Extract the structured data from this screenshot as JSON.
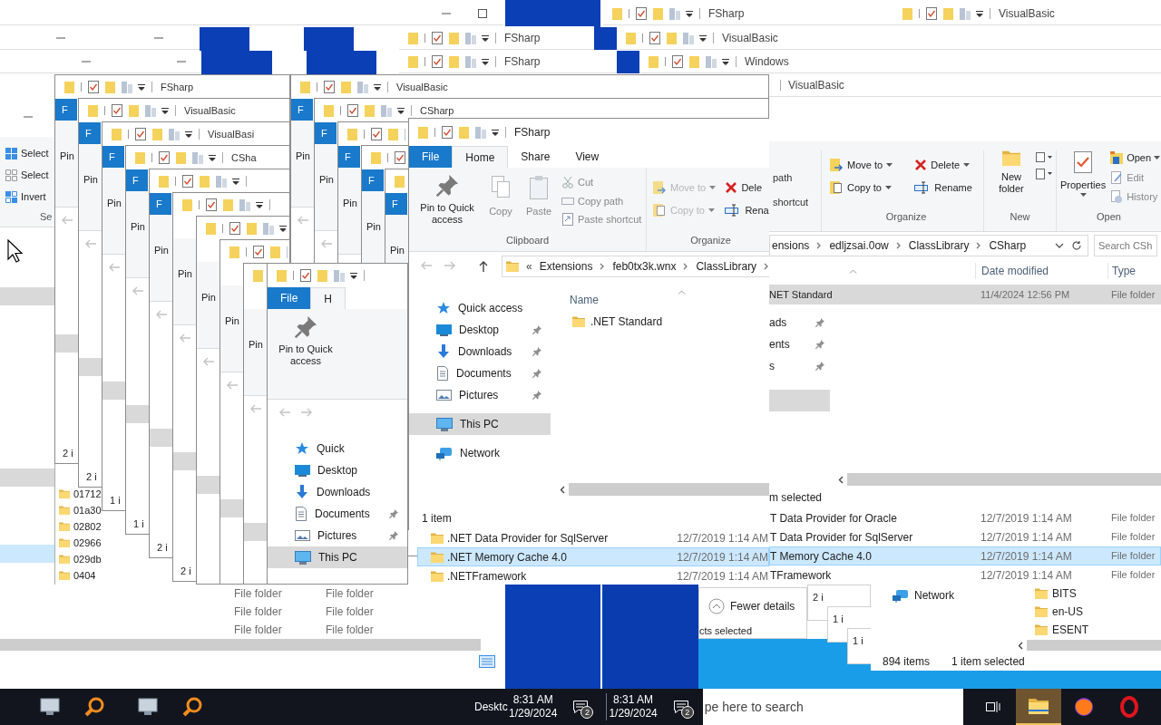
{
  "title_bars": [
    {
      "title": "FSharp"
    },
    {
      "title": "VisualBasic"
    },
    {
      "title": "FSharp"
    },
    {
      "title": "VisualBasic"
    },
    {
      "title": "FSharp"
    },
    {
      "title": "Windows"
    },
    {
      "title": "VisualBasic"
    }
  ],
  "back_window": {
    "commands": [
      {
        "label": "Select",
        "kind": "select_all"
      },
      {
        "label": "Select",
        "kind": "select_none"
      },
      {
        "label": "Invert",
        "kind": "invert"
      }
    ],
    "group_label": "Se"
  },
  "folder_list": [
    "01712",
    "01a30",
    "02802",
    "02966",
    "029db",
    "0404"
  ],
  "cascade": [
    {
      "title": "FSharp",
      "tab": "F",
      "pin": "Pin",
      "status": "2 i"
    },
    {
      "title": "VisualBasic",
      "tab": "F",
      "pin": "Pin",
      "status": "2 i"
    },
    {
      "title": "VisualBasi",
      "tab": "F",
      "pin": "Pin",
      "status": "1 i"
    },
    {
      "title": "CSha",
      "tab": "F",
      "pin": "Pin",
      "status": "1 i"
    },
    {
      "tab": "F",
      "pin": "Pin",
      "status": "2 i"
    },
    {
      "pin": "Pin",
      "status": "2 i"
    },
    {
      "pin": "Pin"
    },
    {
      "pin": "Pin"
    },
    {
      "pin": "Pin"
    }
  ],
  "cascade_2": [
    {
      "title": "VisualBasic",
      "tab": "F",
      "pin": "Pin"
    },
    {
      "title": "CSharp",
      "tab": "F",
      "pin": "Pin"
    },
    {
      "tab": "F",
      "pin": "Pin"
    },
    {
      "tab": "F",
      "pin": "Pin"
    },
    {
      "tab": "F",
      "pin": "Pin"
    }
  ],
  "small_window": {
    "tabs": [
      {
        "label": "File",
        "kind": "file",
        "selected": false
      },
      {
        "label": "H",
        "kind": "tab",
        "selected": true
      }
    ],
    "pin": "Pin to Quick access",
    "nav": [
      {
        "label": "Quick",
        "kind": "quick",
        "pinned": false,
        "selected": false
      },
      {
        "label": "Desktop",
        "kind": "desktop",
        "pinned": false,
        "selected": false
      },
      {
        "label": "Downloads",
        "kind": "downloads",
        "pinned": false,
        "selected": false
      },
      {
        "label": "Documents",
        "kind": "documents",
        "pinned": true,
        "selected": false
      },
      {
        "label": "Pictures",
        "kind": "pictures",
        "pinned": true,
        "selected": false
      },
      {
        "label": "This PC",
        "kind": "pc",
        "pinned": false,
        "selected": true
      }
    ]
  },
  "fsharp_window": {
    "title": "FSharp",
    "tabs": [
      {
        "label": "File",
        "kind": "file",
        "selected": false
      },
      {
        "label": "Home",
        "kind": "tab",
        "selected": true
      },
      {
        "label": "Share",
        "kind": "tab",
        "selected": false
      },
      {
        "label": "View",
        "kind": "tab",
        "selected": false
      }
    ],
    "clipboard": {
      "pin": "Pin to Quick access",
      "copy": "Copy",
      "paste": "Paste",
      "small": [
        "Cut",
        "Copy path",
        "Paste shortcut"
      ],
      "label": "Clipboard"
    },
    "organize": {
      "items": [
        {
          "label": "Move to",
          "kind": "move",
          "dropdown": true,
          "disabled": true
        },
        {
          "label": "Dele",
          "kind": "delete",
          "dropdown": false,
          "disabled": false
        },
        {
          "label": "Copy to",
          "kind": "copy",
          "dropdown": true,
          "disabled": true
        },
        {
          "label": "Rena",
          "kind": "rename",
          "dropdown": false,
          "disabled": false
        }
      ],
      "label": "Organize"
    },
    "address": {
      "overflow": "«",
      "crumbs": [
        "Extensions",
        "feb0tx3k.wnx",
        "ClassLibrary"
      ]
    },
    "nav": [
      {
        "label": "Quick access",
        "kind": "quick",
        "pinned": false,
        "selected": false
      },
      {
        "label": "Desktop",
        "kind": "desktop",
        "pinned": true,
        "selected": false
      },
      {
        "label": "Downloads",
        "kind": "downloads",
        "pinned": true,
        "selected": false
      },
      {
        "label": "Documents",
        "kind": "documents",
        "pinned": true,
        "selected": false
      },
      {
        "label": "Pictures",
        "kind": "pictures",
        "pinned": true,
        "selected": false
      },
      {
        "label": "This PC",
        "kind": "pc",
        "pinned": false,
        "selected": true
      },
      {
        "label": "Network",
        "kind": "network",
        "pinned": false,
        "selected": false
      }
    ],
    "column": "Name",
    "rows": [
      {
        "name": ".NET Standard"
      }
    ],
    "status": "1 item"
  },
  "csharp_window": {
    "clipboard_fragments": [
      "path",
      "shortcut"
    ],
    "organize": {
      "items": [
        {
          "label": "Move to",
          "kind": "move"
        },
        {
          "label": "Delete",
          "kind": "delete"
        },
        {
          "label": "Copy to",
          "kind": "copy"
        },
        {
          "label": "Rename",
          "kind": "rename"
        }
      ],
      "label": "Organize"
    },
    "new": {
      "folder": "New folder",
      "label": "New"
    },
    "properties": "Properties",
    "open": {
      "items": [
        {
          "label": "Open",
          "kind": "open"
        },
        {
          "label": "Edit",
          "kind": "edit"
        },
        {
          "label": "History",
          "kind": "history"
        }
      ],
      "label": "Open"
    },
    "crumbs": [
      "ensions",
      "edljzsai.0ow",
      "ClassLibrary",
      "CSharp"
    ],
    "search": {
      "placeholder": "Search CSh"
    },
    "columns": [
      "Date modified",
      "Type"
    ],
    "rows": [
      {
        "name": "NET Standard",
        "date": "11/4/2024 12:56 PM",
        "type": "File folder",
        "selected": true
      }
    ],
    "status": "m selected"
  },
  "nav_fragment": [
    "ads",
    "ents",
    "s"
  ],
  "list_left": [
    {
      "name": ".NET Data Provider for SqlServer",
      "date": "12/7/2019 1:14 AM",
      "selected": false
    },
    {
      "name": ".NET Memory Cache 4.0",
      "date": "12/7/2019 1:14 AM",
      "selected": true
    },
    {
      "name": ".NETFramework",
      "date": "12/7/2019 1:14 AM",
      "selected": false
    }
  ],
  "list_right": [
    {
      "name": "T Data Provider for Oracle",
      "date": "12/7/2019 1:14 AM",
      "type": "File folder",
      "selected": false
    },
    {
      "name": "T Data Provider for SqlServer",
      "date": "12/7/2019 1:14 AM",
      "type": "File folder",
      "selected": false
    },
    {
      "name": "T Memory Cache 4.0",
      "date": "12/7/2019 1:14 AM",
      "type": "File folder",
      "selected": true
    },
    {
      "name": "TFramework",
      "date": "12/7/2019 1:14 AM",
      "type": "File folder",
      "selected": false
    }
  ],
  "type_window": [
    [
      "File folder",
      "File folder"
    ],
    [
      "File folder",
      "File folder"
    ],
    [
      "File folder",
      "File folder"
    ]
  ],
  "details_toggle": "Fewer details",
  "selection_note": "cts selected",
  "bottom_strips": [
    "2 i",
    "1 i",
    "1 i"
  ],
  "network_window": {
    "nav": "Network",
    "folders": [
      "BITS",
      "en-US",
      "ESENT"
    ],
    "item_count": "894 items",
    "selection": "1 item selected"
  },
  "taskbar": {
    "apps_left": [
      {
        "kind": "window"
      },
      {
        "kind": "magnifier"
      },
      {
        "kind": "window"
      },
      {
        "kind": "magnifier"
      }
    ],
    "desktop_label": "Desktc",
    "clocks": [
      {
        "time": "8:31 AM",
        "date": "1/29/2024",
        "badge": "2"
      },
      {
        "time": "8:31 AM",
        "date": "1/29/2024",
        "badge": "2"
      }
    ],
    "search": {
      "placeholder": "pe here to search"
    },
    "apps_right": [
      {
        "kind": "taskview",
        "active": false
      },
      {
        "kind": "explorer",
        "active": true
      },
      {
        "kind": "firefox",
        "active": false
      },
      {
        "kind": "opera",
        "active": false
      }
    ]
  }
}
